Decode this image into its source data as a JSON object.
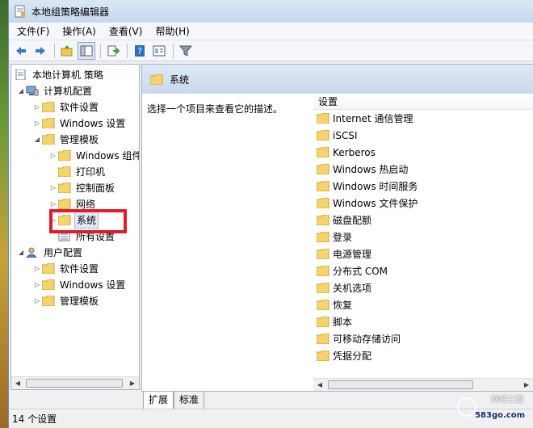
{
  "window": {
    "title": "本地组策略编辑器"
  },
  "menu": [
    "文件(F)",
    "操作(A)",
    "查看(V)",
    "帮助(H)"
  ],
  "toolbar": [
    "back-icon",
    "forward-icon",
    "up-folder-icon",
    "show-hide-tree-icon",
    "export-list-icon",
    "help-icon",
    "properties-icon",
    "filter-icon"
  ],
  "tree": {
    "root": "本地计算机 策略",
    "computer": "计算机配置",
    "computer_software": "软件设置",
    "computer_windows": "Windows 设置",
    "computer_admin": "管理模板",
    "windows_components": "Windows 组件",
    "printers": "打印机",
    "control_panel": "控制面板",
    "network": "网络",
    "system": "系统",
    "all_settings": "所有设置",
    "user": "用户配置",
    "user_software": "软件设置",
    "user_windows": "Windows 设置",
    "user_admin": "管理模板"
  },
  "right": {
    "header": "系统",
    "description": "选择一个项目来查看它的描述。",
    "column": "设置",
    "items": [
      "Internet 通信管理",
      "iSCSI",
      "Kerberos",
      "Windows 热启动",
      "Windows 时间服务",
      "Windows 文件保护",
      "磁盘配额",
      "登录",
      "电源管理",
      "分布式 COM",
      "关机选项",
      "恢复",
      "脚本",
      "可移动存储访问",
      "凭据分配"
    ]
  },
  "tabs": [
    "扩展",
    "标准"
  ],
  "status": "14 个设置",
  "watermark": {
    "name": "网吧三国",
    "site": "583go.com"
  },
  "colors": {
    "highlight_box": "#e01a2a",
    "folder": "#f5d46e"
  }
}
